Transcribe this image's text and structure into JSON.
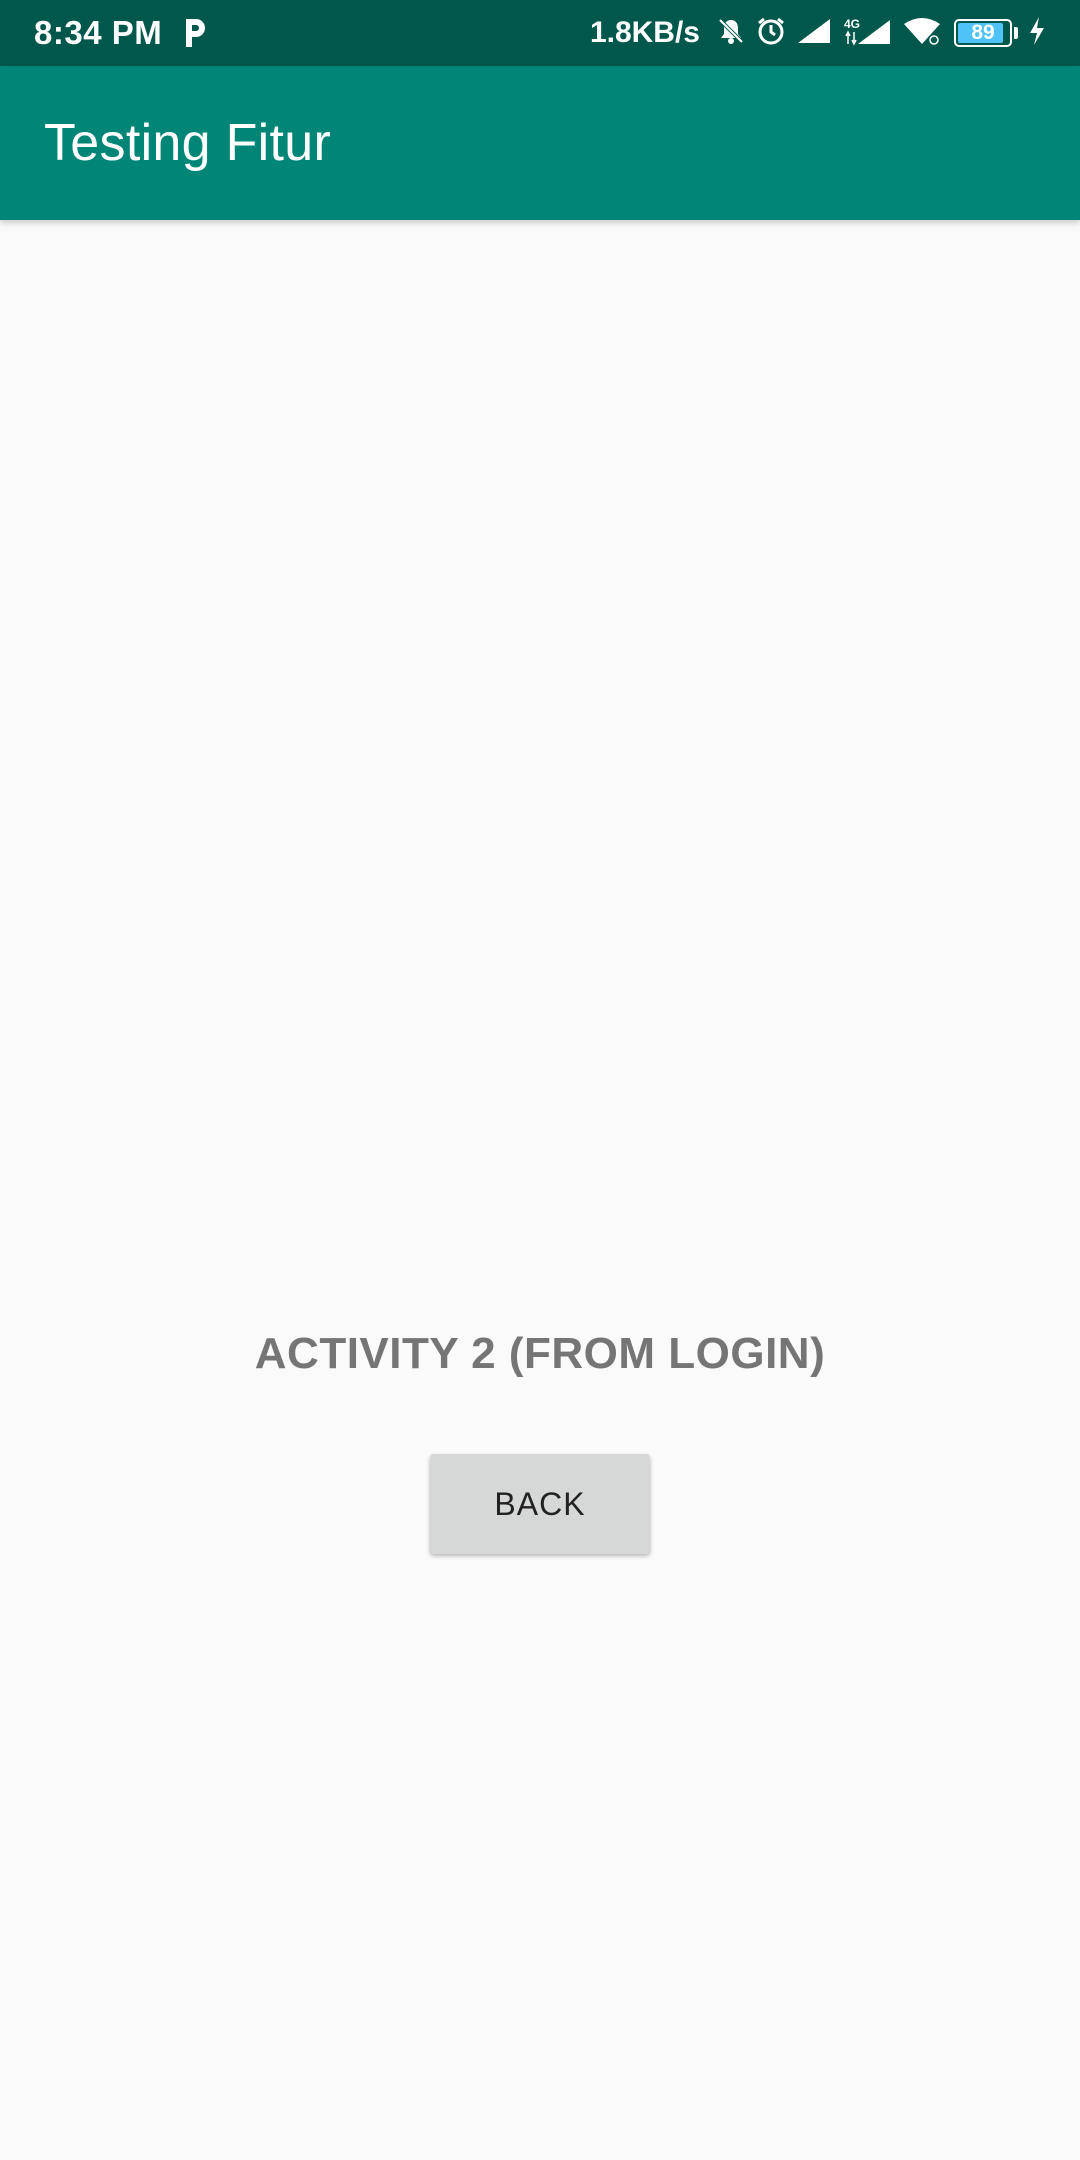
{
  "status_bar": {
    "time": "8:34 PM",
    "network_speed": "1.8KB/s",
    "network_type": "4G",
    "battery_level": "89",
    "battery_fraction": 0.89,
    "icons": [
      "parking-icon",
      "mute-bell-icon",
      "alarm-icon",
      "signal-icon",
      "signal-4g-icon",
      "wifi-icon",
      "battery-icon",
      "charging-icon"
    ],
    "background_color": "#00574b"
  },
  "app_bar": {
    "title": "Testing Fitur",
    "background_color": "#008577"
  },
  "main": {
    "activity_label": "ACTIVITY 2 (FROM LOGIN)",
    "back_button_label": "BACK"
  }
}
